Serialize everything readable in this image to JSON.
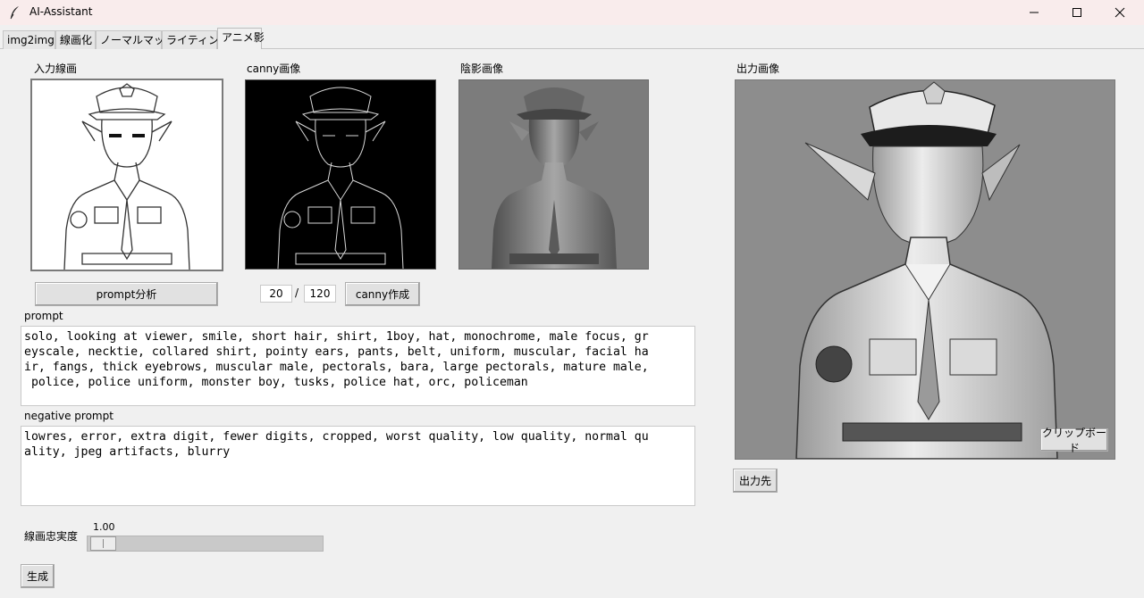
{
  "window": {
    "title": "AI-Assistant",
    "icon": "feather-icon",
    "controls": [
      "minimize-icon",
      "maximize-icon",
      "close-icon"
    ]
  },
  "tabs": [
    {
      "label": "img2img",
      "active": false
    },
    {
      "label": "線画化",
      "active": false
    },
    {
      "label": "ノーマルマップ",
      "active": false
    },
    {
      "label": "ライティング",
      "active": false
    },
    {
      "label": "アニメ影",
      "active": true
    }
  ],
  "panels": {
    "input_lineart": "入力線画",
    "canny_image": "canny画像",
    "shadow_image": "陰影画像",
    "output_image": "出力画像"
  },
  "buttons": {
    "prompt_analyze": "prompt分析",
    "canny_create": "canny作成",
    "clipboard": "クリップボード",
    "output_dest": "出力先",
    "generate": "生成"
  },
  "canny": {
    "low_threshold": "20",
    "separator": "/",
    "high_threshold": "120"
  },
  "prompt": {
    "label": "prompt",
    "value": "solo, looking at viewer, smile, short hair, shirt, 1boy, hat, monochrome, male focus, gr\neyscale, necktie, collared shirt, pointy ears, pants, belt, uniform, muscular, facial ha\nir, fangs, thick eyebrows, muscular male, pectorals, bara, large pectorals, mature male,\n police, police uniform, monster boy, tusks, police hat, orc, policeman"
  },
  "negative_prompt": {
    "label": "negative prompt",
    "value": "lowres, error, extra digit, fewer digits, cropped, worst quality, low quality, normal qu\nality, jpeg artifacts, blurry"
  },
  "fidelity": {
    "label": "線画忠実度",
    "value_text": "1.00",
    "value": 1.0
  },
  "colors": {
    "window_bg": "#f0f0f0",
    "titlebar_bg": "#f9ecec",
    "canny_bg": "#000000",
    "shadow_bg": "#777777",
    "output_bg": "#8a8a8a"
  }
}
